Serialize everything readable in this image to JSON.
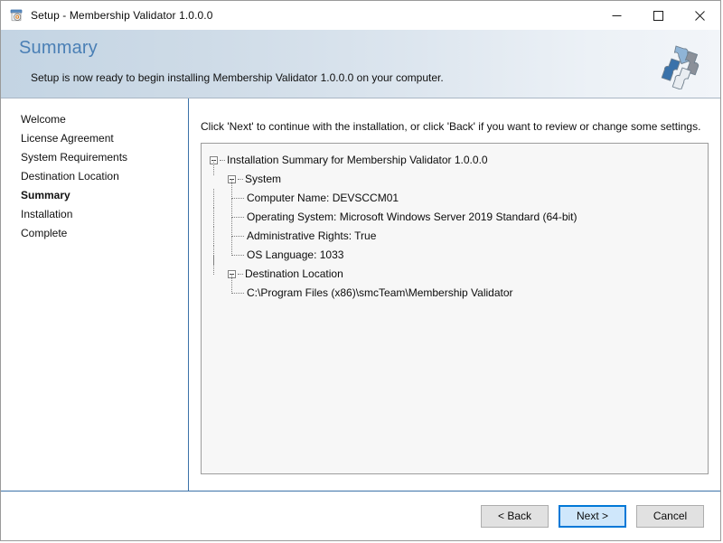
{
  "window": {
    "title": "Setup - Membership Validator 1.0.0.0",
    "icon": "setup-package-icon",
    "controls": {
      "minimize": "minimize-icon",
      "maximize": "maximize-icon",
      "close": "close-icon"
    }
  },
  "header": {
    "title": "Summary",
    "subtitle": "Setup is now ready to begin installing Membership Validator 1.0.0.0 on your computer.",
    "logo": "puzzle-pieces-icon",
    "accent_color": "#4a7fb5",
    "gradient_from": "#c3d4e3",
    "gradient_to": "#f2f5f9"
  },
  "sidebar": {
    "items": [
      {
        "label": "Welcome",
        "active": false
      },
      {
        "label": "License Agreement",
        "active": false
      },
      {
        "label": "System Requirements",
        "active": false
      },
      {
        "label": "Destination Location",
        "active": false
      },
      {
        "label": "Summary",
        "active": true
      },
      {
        "label": "Installation",
        "active": false
      },
      {
        "label": "Complete",
        "active": false
      }
    ]
  },
  "main": {
    "instruction": "Click 'Next' to continue with the installation, or click 'Back' if you want to review or change some settings.",
    "tree": {
      "root": "Installation Summary for Membership Validator 1.0.0.0",
      "groups": [
        {
          "label": "System",
          "items": [
            "Computer Name: DEVSCCM01",
            "Operating System: Microsoft Windows Server 2019 Standard (64-bit)",
            "Administrative Rights: True",
            "OS Language: 1033"
          ]
        },
        {
          "label": "Destination Location",
          "items": [
            "C:\\Program Files (x86)\\smcTeam\\Membership Validator"
          ]
        }
      ]
    }
  },
  "footer": {
    "back_label": "< Back",
    "next_label": "Next >",
    "cancel_label": "Cancel",
    "default_button": "Next >"
  }
}
